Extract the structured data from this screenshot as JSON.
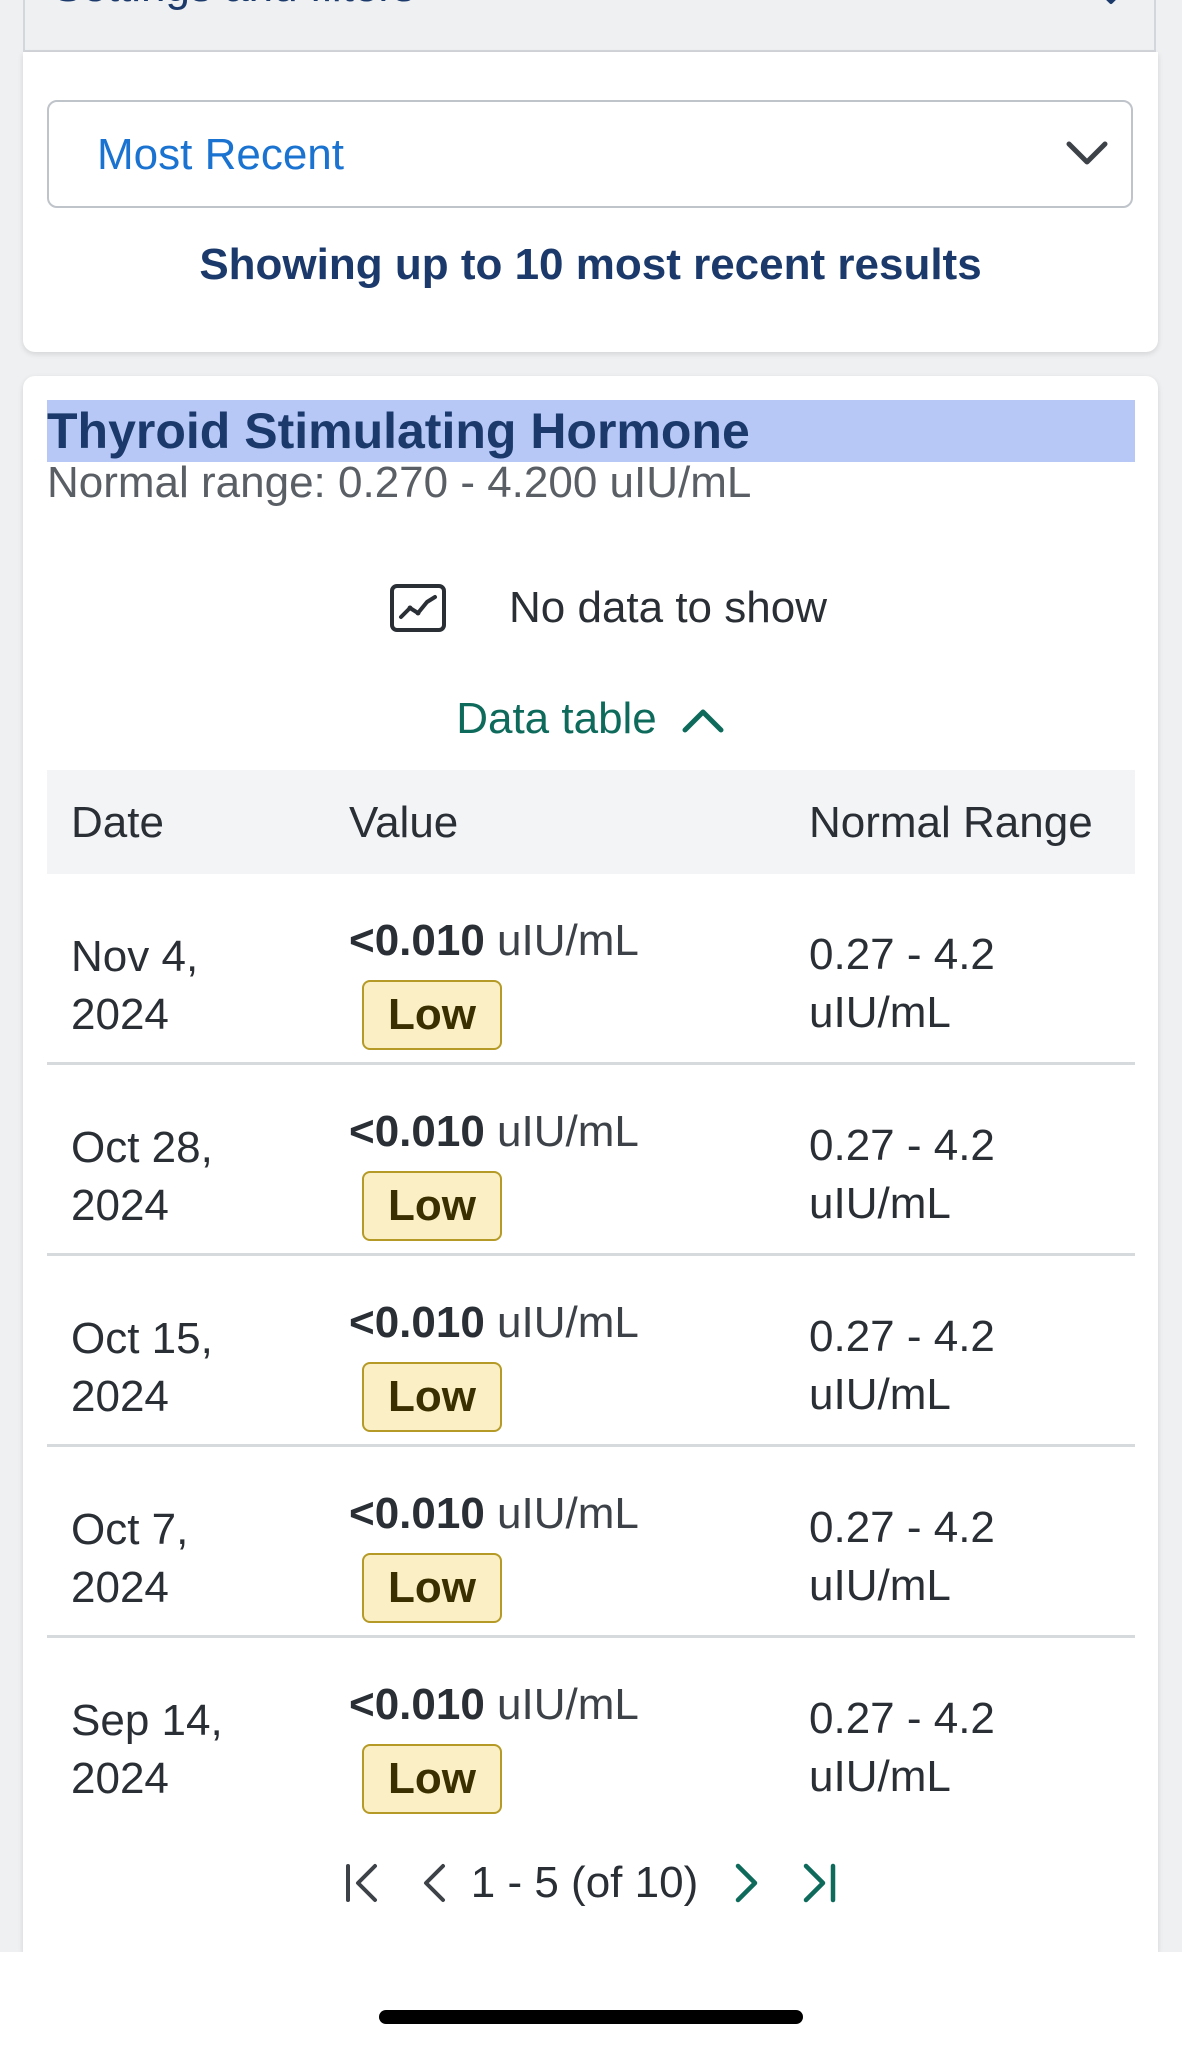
{
  "settings": {
    "label": "Settings and filters"
  },
  "filter": {
    "selected": "Most Recent",
    "showing_text": "Showing up to 10 most recent results"
  },
  "test": {
    "title": "Thyroid Stimulating Hormone",
    "normal_range": "Normal range: 0.270 - 4.200 uIU/mL",
    "no_data": "No data to show",
    "data_table_toggle": "Data table"
  },
  "table": {
    "headers": {
      "date": "Date",
      "value": "Value",
      "range": "Normal Range"
    },
    "rows": [
      {
        "date": "Nov 4, 2024",
        "value": "<0.010",
        "unit": "uIU/mL",
        "flag": "Low",
        "range": "0.27 - 4.2 uIU/mL"
      },
      {
        "date": "Oct 28, 2024",
        "value": "<0.010",
        "unit": "uIU/mL",
        "flag": "Low",
        "range": "0.27 - 4.2 uIU/mL"
      },
      {
        "date": "Oct 15, 2024",
        "value": "<0.010",
        "unit": "uIU/mL",
        "flag": "Low",
        "range": "0.27 - 4.2 uIU/mL"
      },
      {
        "date": "Oct 7, 2024",
        "value": "<0.010",
        "unit": "uIU/mL",
        "flag": "Low",
        "range": "0.27 - 4.2 uIU/mL"
      },
      {
        "date": "Sep 14, 2024",
        "value": "<0.010",
        "unit": "uIU/mL",
        "flag": "Low",
        "range": "0.27 - 4.2 uIU/mL"
      }
    ]
  },
  "pagination": {
    "info": "1 - 5 (of 10)"
  },
  "icons": {
    "settings_chevron": "chevron-down-icon",
    "select_chevron": "chevron-down-icon",
    "no_data": "chart-icon",
    "toggle": "chevron-up-icon",
    "first": "first-page-icon",
    "prev": "prev-page-icon",
    "next": "next-page-icon",
    "last": "last-page-icon"
  },
  "colors": {
    "title_highlight": "#b7c8f6",
    "heading_blue": "#1b3a6b",
    "link_blue": "#1a73d1",
    "teal": "#0e6b5c",
    "badge_bg": "#fbf0c5",
    "badge_border": "#b59a27"
  }
}
